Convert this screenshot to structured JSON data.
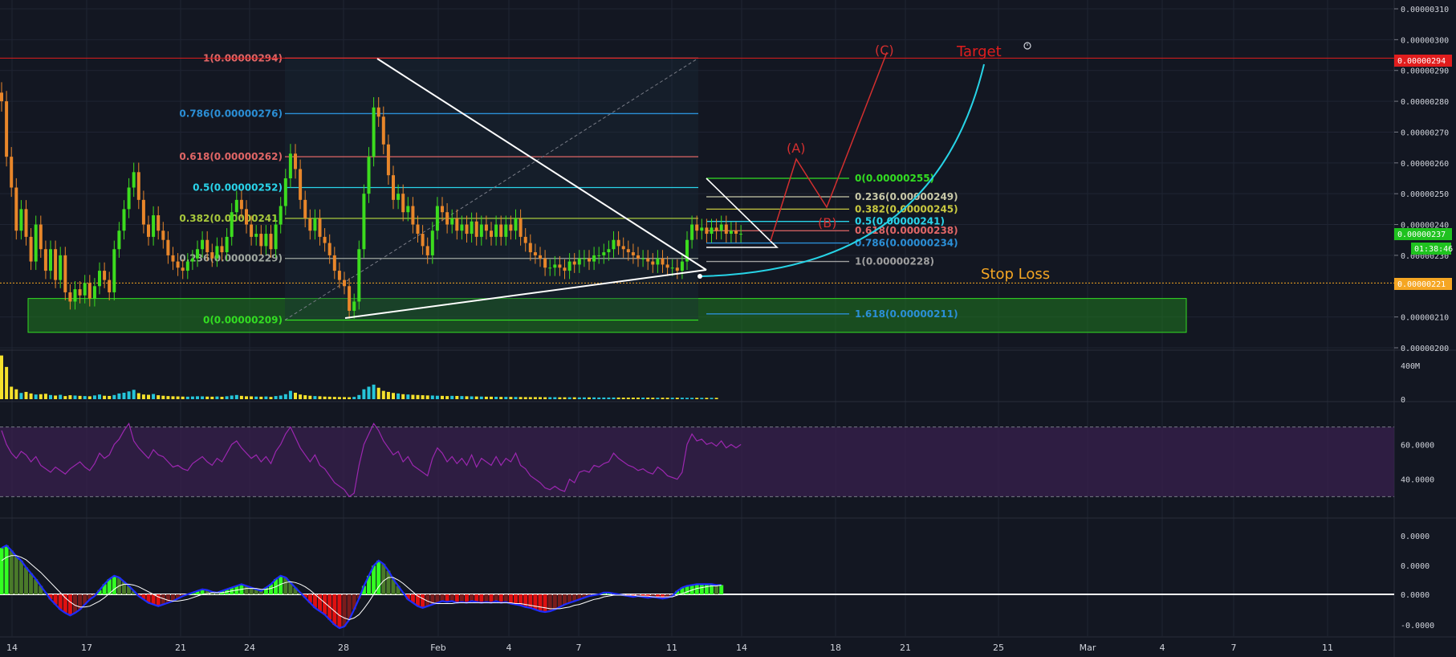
{
  "colors": {
    "background": "#131722",
    "grid": "#1f2433",
    "axis_text": "#d1d4dc",
    "candle_up": "#3cdc1e",
    "candle_down": "#e8862a",
    "volume_up": "#26c6da",
    "volume_down": "#f5e12c",
    "rsi_line": "#9c27b0",
    "rsi_band": "#3b2150",
    "macd_line": "#1e2cff",
    "signal_line": "#ffffff",
    "hist_pos_strong": "#33ff22",
    "hist_pos_weak": "#4a7a2a",
    "hist_neg_strong": "#e01010",
    "hist_neg_weak": "#7a1c1c",
    "target": "#e11d1d",
    "stop_loss": "#f5a623",
    "demand_zone": "#1f7a1f",
    "projection_curve": "#27d3e6",
    "wave_path": "#d32f2f",
    "triangle": "#ffffff"
  },
  "chart_data": [
    {
      "type": "candlestick",
      "pane": "price",
      "y_axis_ticks": [
        "0.00000200",
        "0.00000210",
        "0.00000230",
        "0.00000240",
        "0.00000250",
        "0.00000260",
        "0.00000270",
        "0.00000280",
        "0.00000290",
        "0.00000300",
        "0.00000310"
      ],
      "ylim": [
        2e-06,
        3.1e-06
      ],
      "x_tick_labels": [
        "14",
        "17",
        "21",
        "24",
        "28",
        "Feb",
        "4",
        "7",
        "11",
        "14",
        "18",
        "21",
        "25",
        "Mar",
        "4",
        "7",
        "11"
      ],
      "current_price_label": "0.00000237",
      "countdown_label": "01:38:46",
      "target_price_label": "0.00000294",
      "stop_price_label": "0.00000221",
      "fib_large": [
        {
          "label": "1(0.00000294)",
          "value": 2.94e-06,
          "color": "#e06666"
        },
        {
          "label": "0.786(0.00000276)",
          "value": 2.76e-06,
          "color": "#2b8fd6"
        },
        {
          "label": "0.618(0.00000262)",
          "value": 2.62e-06,
          "color": "#e06666"
        },
        {
          "label": "0.5(0.00000252)",
          "value": 2.52e-06,
          "color": "#2ad4ea"
        },
        {
          "label": "0.382(0.00000241)",
          "value": 2.42e-06,
          "color": "#a8c83c"
        },
        {
          "label": "0.236(0.00000229)",
          "value": 2.29e-06,
          "color": "#a0a8a0"
        },
        {
          "label": "0(0.00000209)",
          "value": 2.09e-06,
          "color": "#33dd22"
        }
      ],
      "fib_small": [
        {
          "label": "0(0.00000255)",
          "value": 2.55e-06,
          "color": "#33dd22"
        },
        {
          "label": "0.236(0.00000249)",
          "value": 2.49e-06,
          "color": "#c8c8a8"
        },
        {
          "label": "0.382(0.00000245)",
          "value": 2.45e-06,
          "color": "#c8c840"
        },
        {
          "label": "0.5(0.00000241)",
          "value": 2.41e-06,
          "color": "#2ad4ea"
        },
        {
          "label": "0.618(0.00000238)",
          "value": 2.38e-06,
          "color": "#e06666"
        },
        {
          "label": "0.786(0.00000234)",
          "value": 2.34e-06,
          "color": "#2b8fd6"
        },
        {
          "label": "1(0.00000228)",
          "value": 2.28e-06,
          "color": "#a0a0a0"
        },
        {
          "label": "1.618(0.00000211)",
          "value": 2.11e-06,
          "color": "#2b8fd6"
        }
      ],
      "annotations": {
        "target": "Target",
        "stop_loss": "Stop Loss",
        "wave_a": "(A)",
        "wave_b": "(B)",
        "wave_c": "(C)"
      },
      "closes": [
        2.8e-06,
        2.62e-06,
        2.52e-06,
        2.38e-06,
        2.45e-06,
        2.36e-06,
        2.28e-06,
        2.4e-06,
        2.32e-06,
        2.25e-06,
        2.32e-06,
        2.22e-06,
        2.3e-06,
        2.18e-06,
        2.15e-06,
        2.19e-06,
        2.17e-06,
        2.21e-06,
        2.16e-06,
        2.2e-06,
        2.25e-06,
        2.22e-06,
        2.18e-06,
        2.32e-06,
        2.38e-06,
        2.45e-06,
        2.52e-06,
        2.57e-06,
        2.48e-06,
        2.4e-06,
        2.36e-06,
        2.43e-06,
        2.38e-06,
        2.35e-06,
        2.3e-06,
        2.28e-06,
        2.26e-06,
        2.25e-06,
        2.28e-06,
        2.29e-06,
        2.32e-06,
        2.35e-06,
        2.31e-06,
        2.29e-06,
        2.33e-06,
        2.31e-06,
        2.36e-06,
        2.44e-06,
        2.48e-06,
        2.45e-06,
        2.4e-06,
        2.36e-06,
        2.37e-06,
        2.33e-06,
        2.37e-06,
        2.32e-06,
        2.4e-06,
        2.46e-06,
        2.55e-06,
        2.63e-06,
        2.58e-06,
        2.48e-06,
        2.42e-06,
        2.38e-06,
        2.42e-06,
        2.36e-06,
        2.34e-06,
        2.3e-06,
        2.25e-06,
        2.22e-06,
        2.2e-06,
        2.12e-06,
        2.15e-06,
        2.32e-06,
        2.5e-06,
        2.62e-06,
        2.78e-06,
        2.75e-06,
        2.66e-06,
        2.56e-06,
        2.48e-06,
        2.5e-06,
        2.44e-06,
        2.46e-06,
        2.4e-06,
        2.37e-06,
        2.33e-06,
        2.3e-06,
        2.38e-06,
        2.46e-06,
        2.44e-06,
        2.4e-06,
        2.42e-06,
        2.38e-06,
        2.4e-06,
        2.37e-06,
        2.41e-06,
        2.36e-06,
        2.4e-06,
        2.38e-06,
        2.36e-06,
        2.4e-06,
        2.36e-06,
        2.4e-06,
        2.38e-06,
        2.42e-06,
        2.36e-06,
        2.34e-06,
        2.31e-06,
        2.3e-06,
        2.29e-06,
        2.26e-06,
        2.26e-06,
        2.27e-06,
        2.26e-06,
        2.25e-06,
        2.28e-06,
        2.27e-06,
        2.29e-06,
        2.29e-06,
        2.28e-06,
        2.3e-06,
        2.3e-06,
        2.31e-06,
        2.32e-06,
        2.35e-06,
        2.33e-06,
        2.32e-06,
        2.31e-06,
        2.3e-06,
        2.29e-06,
        2.29e-06,
        2.28e-06,
        2.27e-06,
        2.29e-06,
        2.27e-06,
        2.26e-06,
        2.26e-06,
        2.25e-06,
        2.28e-06,
        2.35e-06,
        2.4e-06,
        2.38e-06,
        2.39e-06,
        2.37e-06,
        2.39e-06,
        2.38e-06,
        2.4e-06,
        2.37e-06,
        2.38e-06,
        2.37e-06,
        2.37e-06
      ]
    },
    {
      "type": "bar",
      "pane": "volume",
      "y_axis_ticks": [
        "400M",
        "0"
      ],
      "values": [
        420,
        310,
        120,
        95,
        60,
        70,
        55,
        45,
        48,
        52,
        40,
        35,
        42,
        30,
        38,
        35,
        32,
        30,
        28,
        36,
        45,
        33,
        31,
        40,
        55,
        62,
        75,
        90,
        58,
        45,
        42,
        50,
        38,
        33,
        30,
        28,
        27,
        25,
        24,
        26,
        28,
        27,
        25,
        24,
        26,
        23,
        28,
        35,
        40,
        32,
        28,
        27,
        25,
        24,
        26,
        22,
        30,
        35,
        48,
        80,
        62,
        45,
        38,
        33,
        30,
        28,
        25,
        24,
        22,
        21,
        20,
        19,
        22,
        40,
        95,
        120,
        140,
        110,
        80,
        70,
        60,
        55,
        48,
        45,
        42,
        40,
        38,
        36,
        35,
        33,
        32,
        30,
        32,
        31,
        30,
        28,
        27,
        26,
        25,
        24,
        24,
        23,
        22,
        22,
        22,
        21,
        21,
        20,
        20,
        20,
        20,
        19,
        19,
        19,
        18,
        18,
        18,
        18,
        17,
        17,
        17,
        17,
        16,
        16,
        16,
        16,
        16,
        15,
        15,
        15,
        15,
        15,
        15,
        14,
        14,
        14,
        14,
        14,
        14,
        14,
        13,
        13,
        13,
        13,
        13,
        13,
        13
      ]
    },
    {
      "type": "line",
      "pane": "rsi",
      "y_axis_ticks": [
        "40.0000",
        "60.0000"
      ],
      "band": [
        30,
        70
      ],
      "values": [
        68,
        60,
        55,
        52,
        56,
        54,
        50,
        53,
        48,
        46,
        44,
        47,
        45,
        43,
        46,
        48,
        50,
        47,
        45,
        49,
        55,
        52,
        54,
        60,
        63,
        68,
        72,
        62,
        58,
        55,
        52,
        57,
        54,
        53,
        50,
        47,
        48,
        46,
        45,
        49,
        51,
        53,
        50,
        48,
        52,
        50,
        55,
        60,
        62,
        58,
        55,
        52,
        54,
        50,
        53,
        49,
        56,
        60,
        66,
        70,
        64,
        58,
        54,
        50,
        54,
        48,
        46,
        42,
        38,
        36,
        34,
        30,
        32,
        48,
        60,
        66,
        72,
        68,
        62,
        58,
        54,
        56,
        50,
        53,
        48,
        46,
        44,
        42,
        52,
        58,
        55,
        50,
        53,
        49,
        52,
        48,
        54,
        47,
        52,
        50,
        48,
        53,
        48,
        52,
        50,
        55,
        48,
        46,
        42,
        40,
        38,
        35,
        34,
        36,
        34,
        33,
        40,
        38,
        44,
        45,
        44,
        48,
        47,
        49,
        50,
        55,
        52,
        50,
        48,
        47,
        45,
        46,
        44,
        43,
        47,
        45,
        42,
        41,
        40,
        44,
        60,
        66,
        62,
        63,
        60,
        61,
        59,
        62,
        58,
        60,
        58,
        60
      ]
    },
    {
      "type": "line",
      "pane": "macd",
      "y_axis_ticks": [
        "0.0000",
        "0.0000",
        "0.0000",
        "-0.0000"
      ],
      "macd": [
        55,
        58,
        52,
        45,
        40,
        32,
        25,
        18,
        10,
        2,
        -6,
        -12,
        -18,
        -22,
        -25,
        -22,
        -18,
        -12,
        -6,
        -2,
        5,
        12,
        18,
        22,
        20,
        15,
        10,
        4,
        -2,
        -6,
        -10,
        -12,
        -14,
        -12,
        -10,
        -8,
        -5,
        -2,
        0,
        2,
        4,
        6,
        5,
        3,
        2,
        4,
        6,
        8,
        10,
        12,
        10,
        8,
        6,
        4,
        8,
        12,
        18,
        22,
        20,
        14,
        8,
        2,
        -4,
        -10,
        -16,
        -20,
        -24,
        -30,
        -36,
        -40,
        -38,
        -30,
        -18,
        -5,
        10,
        22,
        34,
        40,
        36,
        28,
        18,
        10,
        2,
        -6,
        -10,
        -14,
        -16,
        -14,
        -12,
        -10,
        -8,
        -9,
        -8,
        -10,
        -9,
        -10,
        -8,
        -9,
        -10,
        -9,
        -10,
        -8,
        -10,
        -9,
        -11,
        -12,
        -13,
        -15,
        -16,
        -18,
        -20,
        -21,
        -20,
        -18,
        -15,
        -12,
        -10,
        -8,
        -6,
        -4,
        -2,
        -1,
        0,
        2,
        2,
        1,
        0,
        -1,
        -2,
        -3,
        -2,
        -3,
        -4,
        -3,
        -4,
        -5,
        -4,
        -2,
        4,
        8,
        10,
        11,
        12,
        12,
        12,
        12,
        11,
        11
      ],
      "signal": [
        40,
        44,
        46,
        46,
        44,
        41,
        36,
        31,
        26,
        20,
        14,
        8,
        2,
        -4,
        -9,
        -13,
        -15,
        -15,
        -14,
        -11,
        -8,
        -4,
        1,
        6,
        10,
        12,
        12,
        11,
        9,
        6,
        3,
        0,
        -3,
        -5,
        -7,
        -8,
        -8,
        -7,
        -6,
        -4,
        -2,
        0,
        1,
        2,
        2,
        2,
        3,
        4,
        5,
        6,
        7,
        7,
        7,
        6,
        6,
        7,
        9,
        12,
        14,
        15,
        14,
        12,
        9,
        5,
        0,
        -5,
        -10,
        -15,
        -20,
        -25,
        -28,
        -30,
        -28,
        -24,
        -17,
        -9,
        0,
        9,
        16,
        20,
        20,
        17,
        13,
        8,
        3,
        -2,
        -5,
        -8,
        -10,
        -11,
        -11,
        -11,
        -11,
        -10,
        -10,
        -10,
        -10,
        -10,
        -10,
        -10,
        -10,
        -10,
        -10,
        -10,
        -10,
        -11,
        -11,
        -12,
        -13,
        -14,
        -15,
        -16,
        -17,
        -17,
        -17,
        -16,
        -15,
        -13,
        -12,
        -10,
        -8,
        -6,
        -5,
        -3,
        -2,
        -1,
        -1,
        -1,
        -1,
        -1,
        -2,
        -2,
        -2,
        -3,
        -3,
        -3,
        -3,
        -3,
        -1,
        1,
        3,
        5,
        7,
        8,
        9,
        10,
        10,
        11
      ]
    }
  ]
}
